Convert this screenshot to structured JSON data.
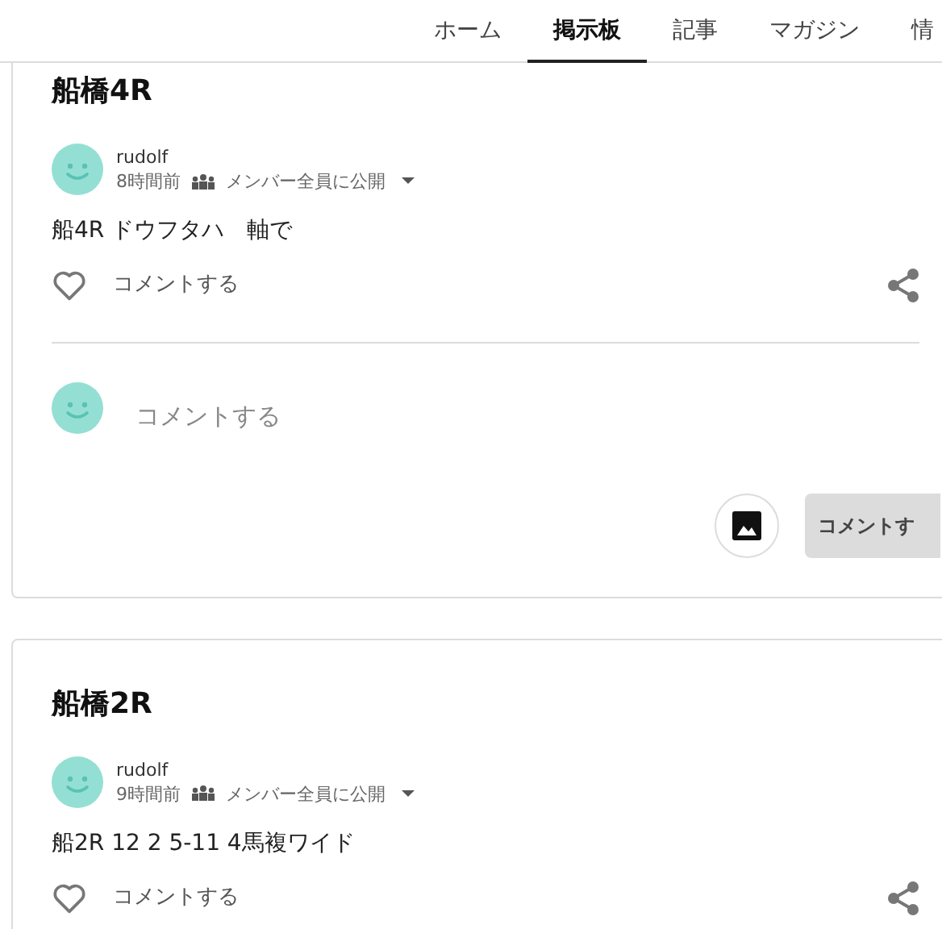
{
  "nav": {
    "tabs": [
      {
        "label": "ホーム",
        "selected": false
      },
      {
        "label": "掲示板",
        "selected": true
      },
      {
        "label": "記事",
        "selected": false
      },
      {
        "label": "マガジン",
        "selected": false
      },
      {
        "label": "情",
        "selected": false
      }
    ]
  },
  "posts": [
    {
      "title": "船橋4R",
      "author": "rudolf",
      "time": "8時間前",
      "visibility": "メンバー全員に公開",
      "body": "船4R ドウフタハ　軸で",
      "comment_action": "コメントする",
      "comment_box": {
        "placeholder": "コメントする",
        "submit_label": "コメントす"
      }
    },
    {
      "title": "船橋2R",
      "author": "rudolf",
      "time": "9時間前",
      "visibility": "メンバー全員に公開",
      "body": "船2R 12 2 5-11 4馬複ワイド",
      "comment_action": "コメントする"
    }
  ]
}
